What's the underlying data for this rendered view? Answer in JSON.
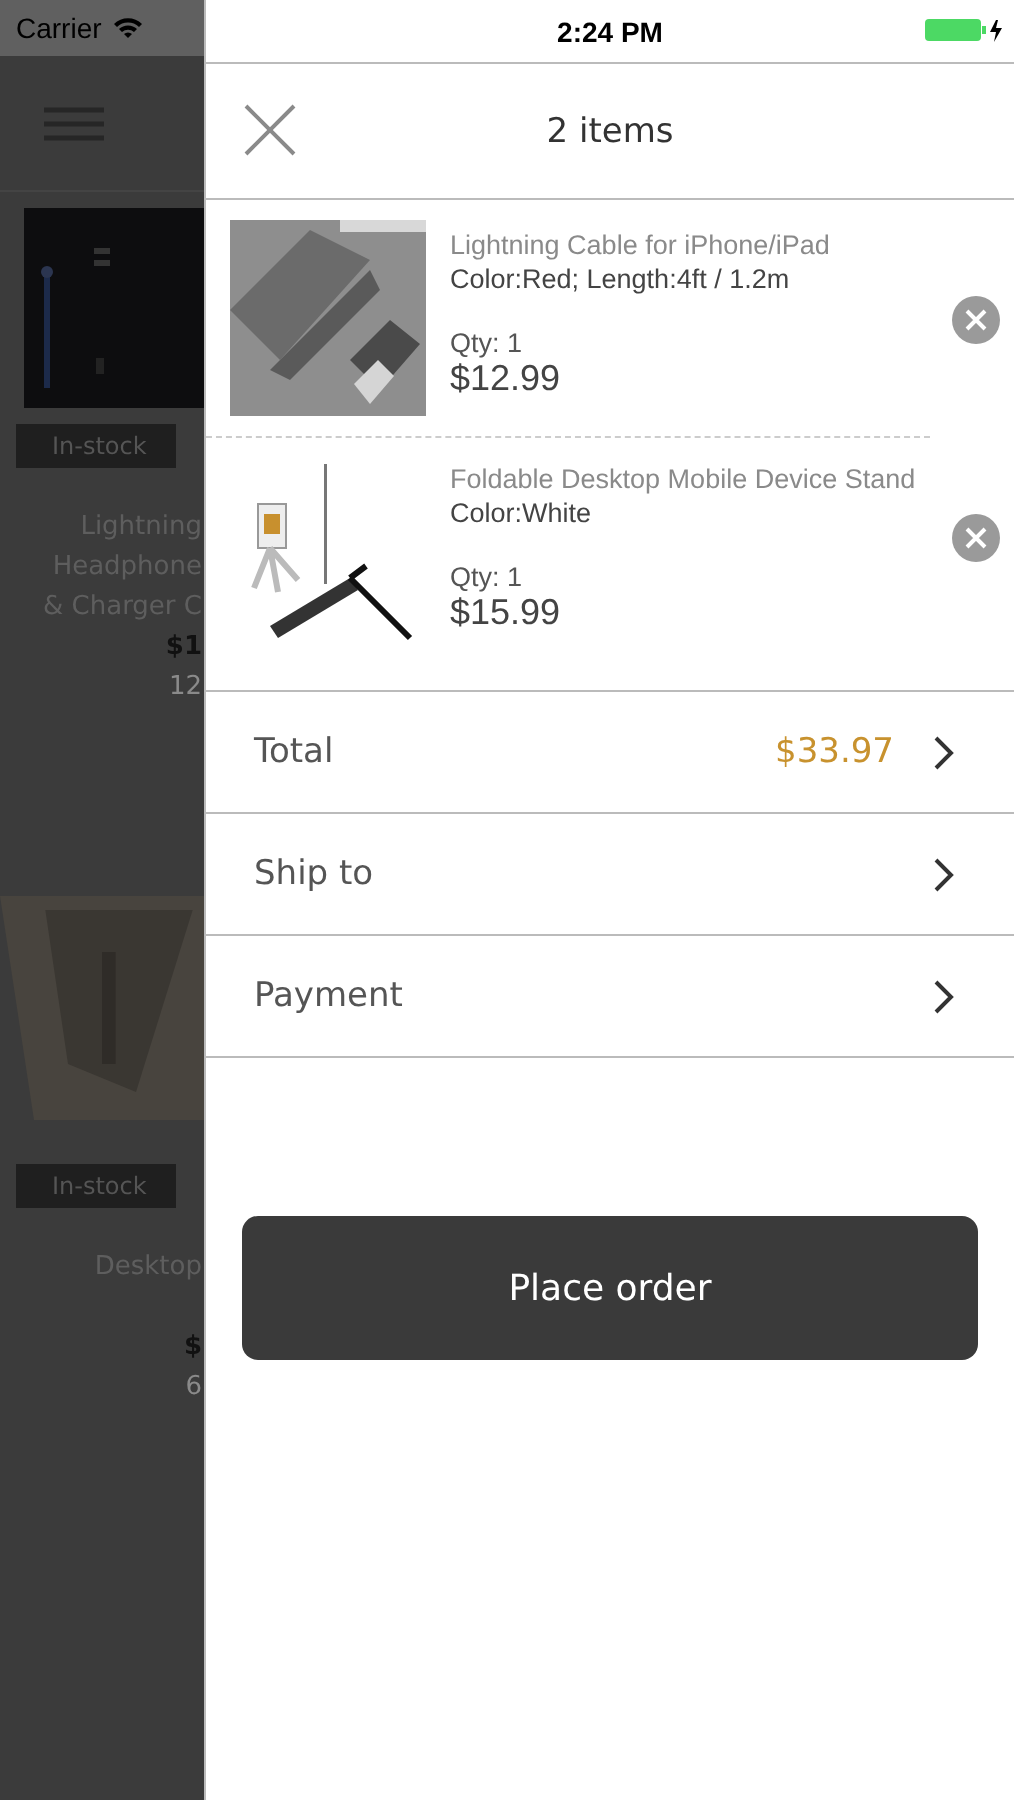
{
  "status_bar": {
    "carrier": "Carrier",
    "time": "2:24 PM"
  },
  "background": {
    "products": [
      {
        "tag": "In-stock",
        "lines": [
          "Lightning",
          "Headphone",
          "& Charger C"
        ],
        "price": "$1",
        "note": "12"
      },
      {
        "tag": "In-stock",
        "lines": [
          "Desktop"
        ],
        "price": "$",
        "note": "6"
      }
    ]
  },
  "cart": {
    "title": "2 items",
    "items": [
      {
        "name": "Lightning Cable for iPhone/iPad",
        "options": "Color:Red; Length:4ft / 1.2m",
        "qty": "Qty: 1",
        "price": "$12.99",
        "kind": "cable"
      },
      {
        "name": "Foldable Desktop Mobile Device Stand",
        "options": "Color:White",
        "qty": "Qty: 1",
        "price": "$15.99",
        "kind": "stand"
      }
    ],
    "summary": [
      {
        "label": "Total",
        "value": "$33.97"
      },
      {
        "label": "Ship to"
      },
      {
        "label": "Payment"
      }
    ],
    "button": "Place order"
  }
}
